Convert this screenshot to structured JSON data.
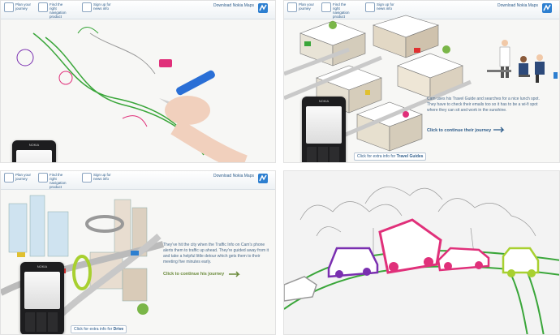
{
  "nav": {
    "items": [
      {
        "label": "Plan your journey",
        "icon": "map-icon"
      },
      {
        "label": "Find the right navigation product",
        "icon": "compass-icon"
      },
      {
        "label": "Sign up for news info",
        "icon": "newsletter-icon"
      }
    ],
    "download_label": "Download Nokia Maps"
  },
  "panel2": {
    "caption": "Cam uses his Travel Guide and searches for a nice lunch spot. They have to check their emails too so it has to be a wi-fi spot where they can sit and work in the sunshine.",
    "cta": "Click to continue their journey",
    "extra_prefix": "Click for extra info for ",
    "extra_topic": "Travel Guides"
  },
  "panel3": {
    "caption": "They've hit the city when the Traffic Info on Cam's phone alerts them to traffic up ahead. They're guided away from it and take a helpful little detour which gets them to their meeting five minutes early.",
    "cta": "Click to continue his journey",
    "extra_prefix": "Click for extra info for ",
    "extra_topic": "Drive"
  },
  "phone_brand": "NOKIA",
  "colors": {
    "link": "#2d5c8a",
    "caption": "#4a6a8a",
    "road": "#3aa63a",
    "pink": "#e0307a",
    "purple": "#7a2fb0",
    "lime": "#a8d030"
  }
}
